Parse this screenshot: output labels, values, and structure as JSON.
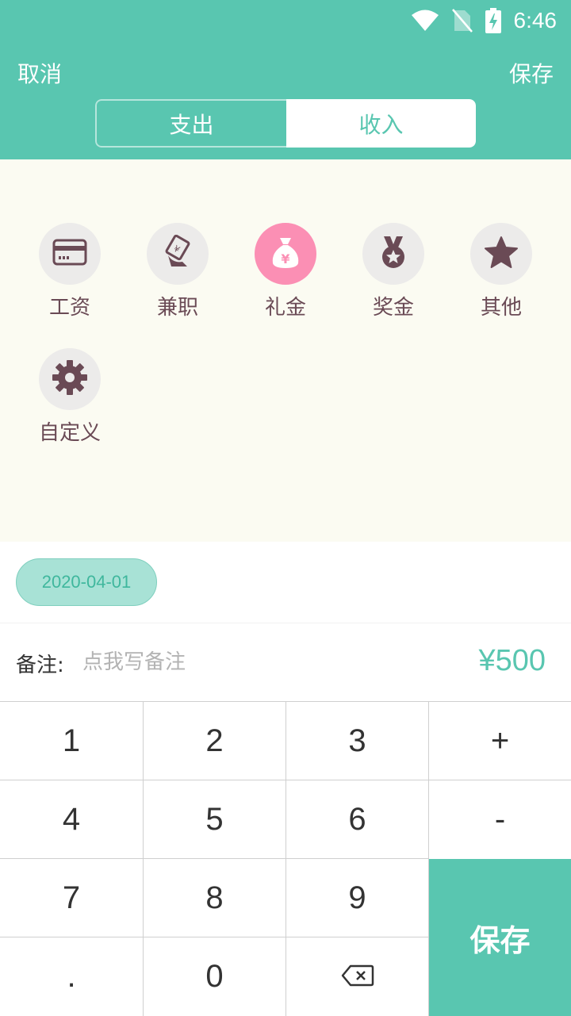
{
  "status_bar": {
    "time": "6:46",
    "icons": [
      "wifi-icon",
      "no-sim-icon",
      "battery-charging-icon"
    ]
  },
  "header": {
    "cancel_label": "取消",
    "save_label": "保存",
    "tabs": [
      {
        "label": "支出",
        "selected": false
      },
      {
        "label": "收入",
        "selected": true
      }
    ]
  },
  "categories": [
    {
      "label": "工资",
      "icon": "card-icon",
      "selected": false
    },
    {
      "label": "兼职",
      "icon": "part-time-hand-icon",
      "selected": false
    },
    {
      "label": "礼金",
      "icon": "money-bag-icon",
      "selected": true
    },
    {
      "label": "奖金",
      "icon": "medal-icon",
      "selected": false
    },
    {
      "label": "其他",
      "icon": "star-icon",
      "selected": false
    },
    {
      "label": "自定义",
      "icon": "gear-icon",
      "selected": false
    }
  ],
  "date": {
    "value": "2020-04-01"
  },
  "note": {
    "label": "备注:",
    "placeholder": "点我写备注",
    "value": ""
  },
  "amount": "¥500",
  "keypad": {
    "keys": [
      "1",
      "2",
      "3",
      "+",
      "4",
      "5",
      "6",
      "-",
      "7",
      "8",
      "9",
      ".",
      "0"
    ],
    "backspace_icon": "backspace-icon",
    "save_label": "保存"
  },
  "colors": {
    "accent": "#59c6b0",
    "selected_category": "#fb8fb4",
    "icon_color": "#6a4a55",
    "category_bg": "#fbfbf2"
  }
}
